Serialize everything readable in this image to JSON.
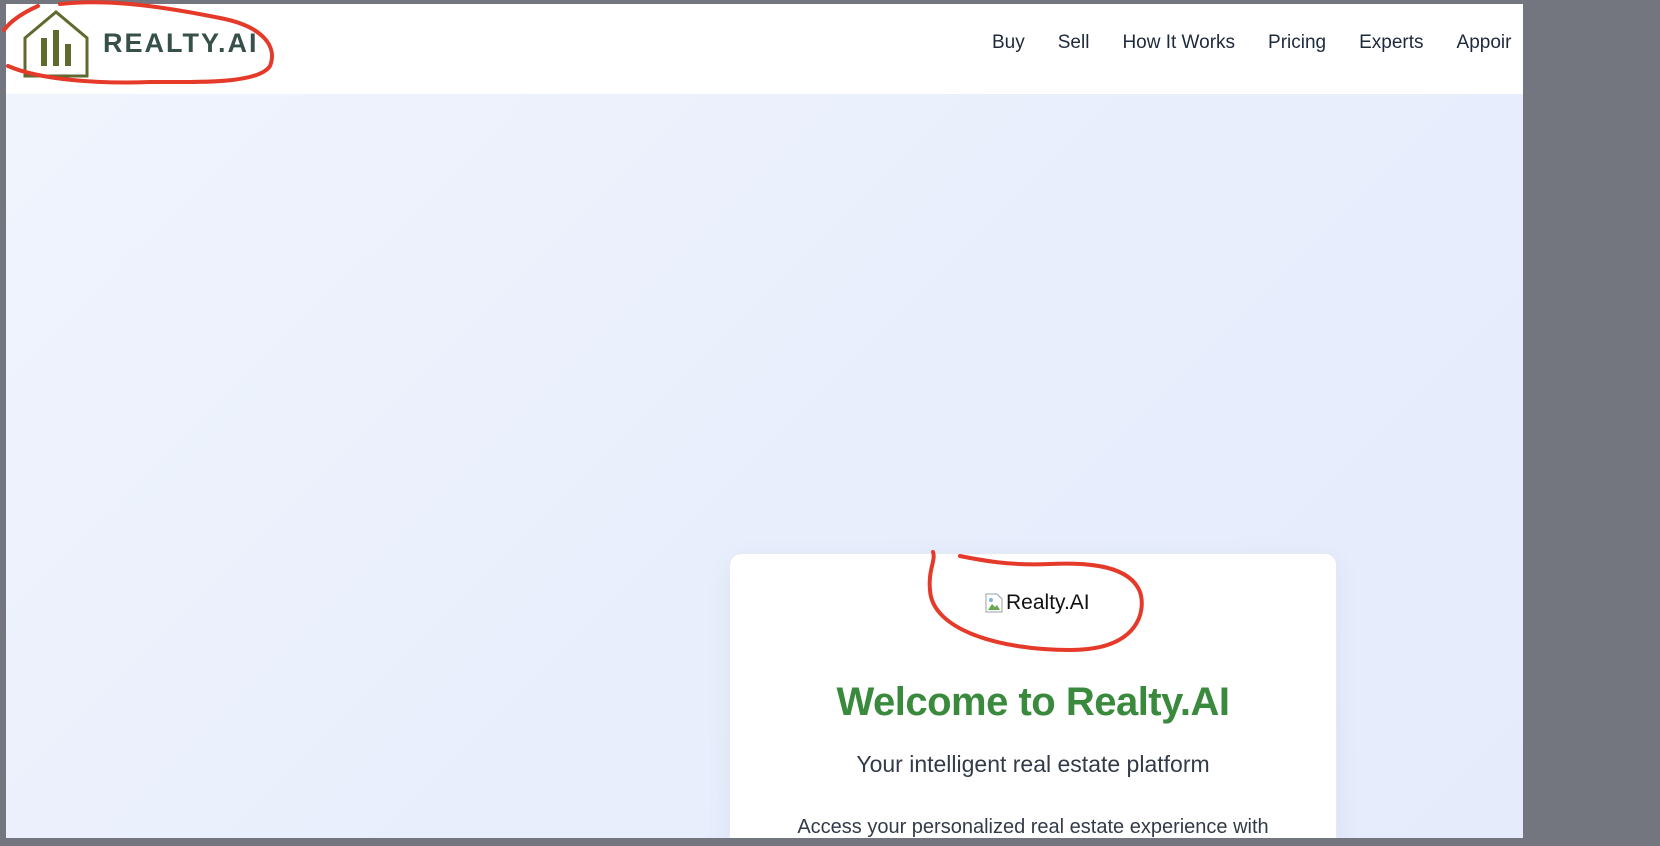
{
  "header": {
    "brand": "REALTY.AI",
    "nav": [
      "Buy",
      "Sell",
      "How It Works",
      "Pricing",
      "Experts",
      "Appoir"
    ]
  },
  "card": {
    "image_alt": "Realty.AI",
    "title": "Welcome to Realty.AI",
    "subtitle": "Your intelligent real estate platform",
    "body": "Access your personalized real estate experience with"
  },
  "colors": {
    "brand_text": "#37504a",
    "logo_stroke": "#5f6a2e",
    "title_green": "#3a8a3d",
    "annotation_red": "#e53a2a",
    "outer_frame": "#74767f"
  },
  "icons": {
    "logo": "house-bar-chart-icon",
    "broken_image": "broken-image-icon"
  }
}
